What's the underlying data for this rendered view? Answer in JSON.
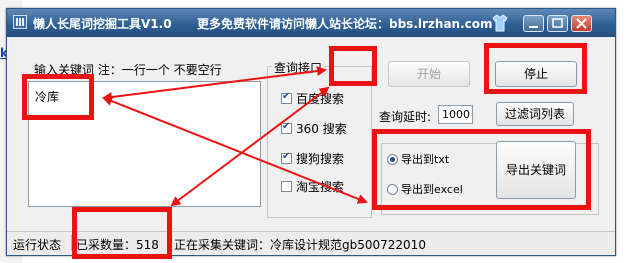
{
  "background": {
    "left_fragment": "k"
  },
  "window": {
    "title": "懒人长尾词挖掘工具V1.0",
    "ad_text": "更多免费软件请访问懒人站长论坛：bbs.lrzhan.com"
  },
  "keywords": {
    "label": "输入关键词  注：一行一个 不要空行",
    "value": "冷库"
  },
  "api_group": {
    "title": "查询接口",
    "options": [
      {
        "label": "百度搜索",
        "checked": true
      },
      {
        "label": "360 搜索",
        "checked": true
      },
      {
        "label": "搜狗搜索",
        "checked": true
      },
      {
        "label": "淘宝搜索",
        "checked": false
      }
    ]
  },
  "buttons": {
    "start": "开始",
    "stop": "停止",
    "filter": "过滤词列表",
    "export": "导出关键词"
  },
  "delay": {
    "label": "查询延时:",
    "value": "1000"
  },
  "export_options": [
    {
      "label": "导出到txt",
      "checked": true
    },
    {
      "label": "导出到excel",
      "checked": false
    }
  ],
  "status": {
    "state_label": "运行状态",
    "count_text": "已采数量：518",
    "current_text": "正在采集关键词：冷库设计规范gb500722010"
  },
  "colors": {
    "title_bar": "#2f5f94",
    "highlight": "#ee1111",
    "window_bg": "#f0f0f0"
  }
}
